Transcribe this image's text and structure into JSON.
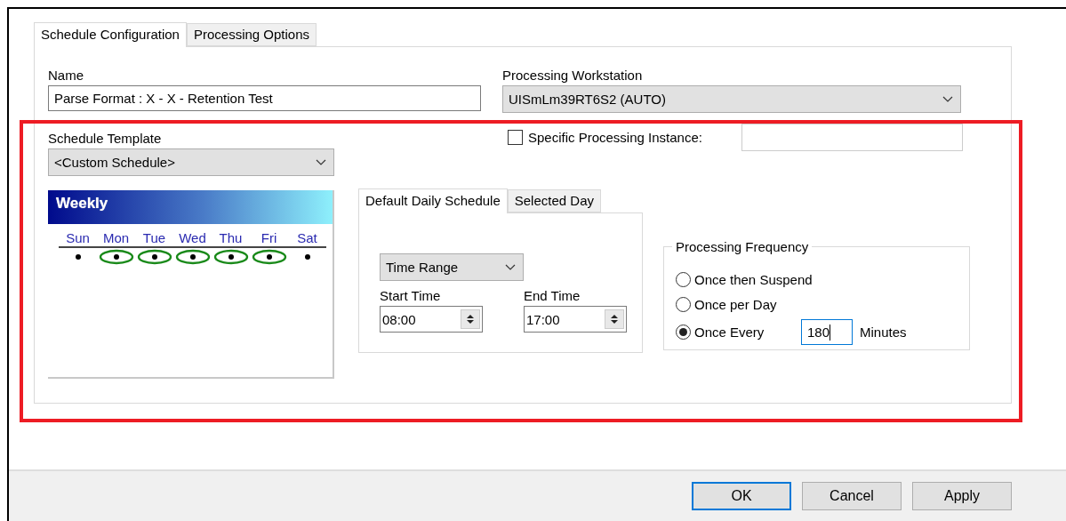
{
  "tabs": [
    {
      "label": "Schedule Configuration",
      "selected": true
    },
    {
      "label": "Processing Options",
      "selected": false
    }
  ],
  "name": {
    "label": "Name",
    "value": "Parse Format : X - X - Retention Test"
  },
  "workstation": {
    "label": "Processing Workstation",
    "value": "UISmLm39RT6S2 (AUTO)"
  },
  "specific_instance": {
    "label": "Specific Processing Instance:",
    "checked": false
  },
  "schedule_template": {
    "label": "Schedule Template",
    "value": "<Custom Schedule>"
  },
  "weekly": {
    "title": "Weekly",
    "days": [
      {
        "label": "Sun",
        "active": false
      },
      {
        "label": "Mon",
        "active": true
      },
      {
        "label": "Tue",
        "active": true
      },
      {
        "label": "Wed",
        "active": true
      },
      {
        "label": "Thu",
        "active": true
      },
      {
        "label": "Fri",
        "active": true
      },
      {
        "label": "Sat",
        "active": false
      }
    ]
  },
  "daily_tabs": [
    {
      "label": "Default Daily Schedule",
      "selected": true
    },
    {
      "label": "Selected Day",
      "selected": false
    }
  ],
  "daily": {
    "mode": "Time Range",
    "start_label": "Start Time",
    "start": "08:00",
    "end_label": "End Time",
    "end": "17:00"
  },
  "frequency": {
    "title": "Processing Frequency",
    "options": [
      {
        "label": "Once then Suspend",
        "selected": false
      },
      {
        "label": "Once per Day",
        "selected": false
      },
      {
        "label": "Once Every",
        "selected": true,
        "value": "180",
        "unit": "Minutes"
      }
    ]
  },
  "buttons": [
    {
      "label": "OK",
      "default": true
    },
    {
      "label": "Cancel",
      "default": false
    },
    {
      "label": "Apply",
      "default": false
    }
  ]
}
